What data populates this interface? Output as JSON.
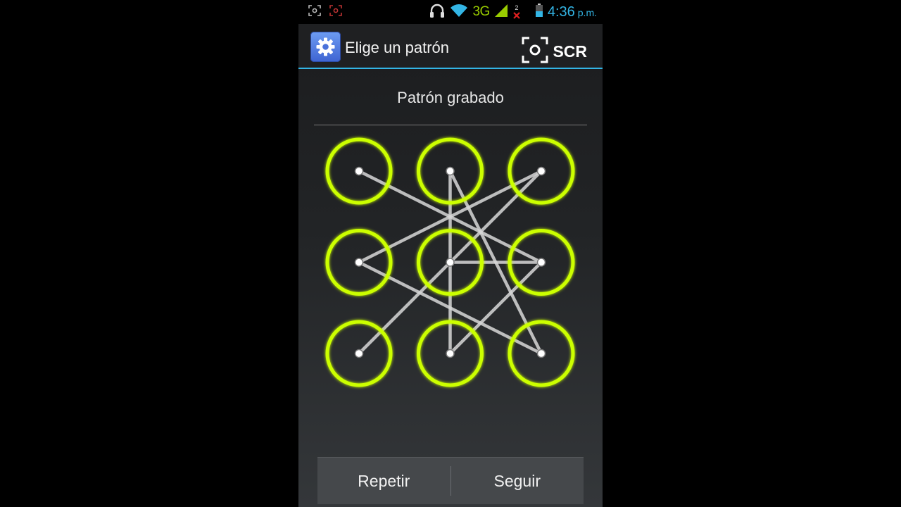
{
  "status_bar": {
    "left_icons": [
      "screenshot-icon",
      "screen-record-icon"
    ],
    "network": "3G",
    "sim_slot_label": "2",
    "time": "4:36",
    "ampm": "p.m.",
    "accent_color": "#33b5e5"
  },
  "action_bar": {
    "title": "Elige un patrón",
    "app_icon": "settings-gear-icon",
    "scr_label": "SCR"
  },
  "header_message": "Patrón grabado",
  "pattern": {
    "grid_size": 3,
    "ring_color": "#ccff00",
    "line_color": "#d8d8d8",
    "selected_dots": [
      1,
      2,
      3,
      4,
      5,
      6,
      7,
      8,
      9
    ],
    "strokes": [
      [
        1,
        6
      ],
      [
        6,
        8
      ],
      [
        8,
        2
      ],
      [
        2,
        9
      ],
      [
        9,
        4
      ],
      [
        4,
        3
      ],
      [
        3,
        7
      ],
      [
        5,
        6
      ]
    ]
  },
  "buttons": {
    "retry": "Repetir",
    "continue": "Seguir"
  }
}
